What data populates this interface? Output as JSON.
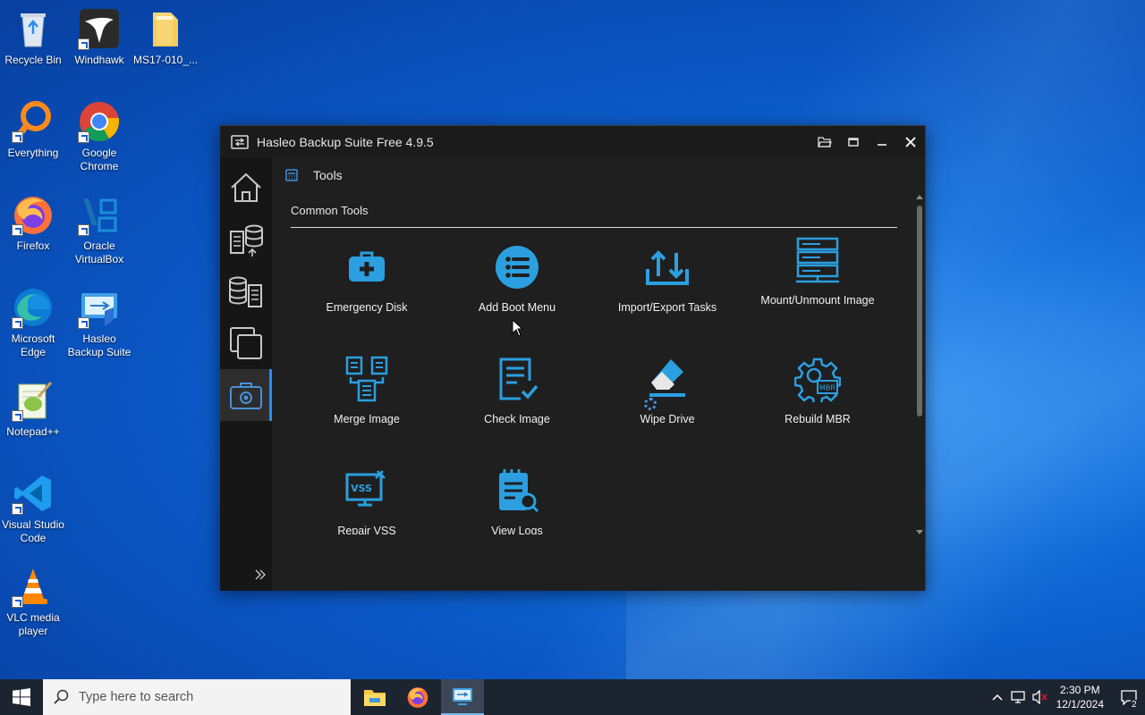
{
  "desktop": {
    "icons": [
      {
        "label": "Recycle Bin"
      },
      {
        "label": "Windhawk"
      },
      {
        "label": "MS17-010_..."
      },
      {
        "label": "Everything"
      },
      {
        "label": "Google Chrome"
      },
      {
        "label": "Firefox"
      },
      {
        "label": "Oracle VirtualBox"
      },
      {
        "label": "Microsoft Edge"
      },
      {
        "label": "Hasleo Backup Suite"
      },
      {
        "label": "Notepad++"
      },
      {
        "label": "Visual Studio Code"
      },
      {
        "label": "VLC media player"
      }
    ]
  },
  "window": {
    "title": "Hasleo Backup Suite Free 4.9.5",
    "breadcrumb": "Tools",
    "section_title": "Common Tools",
    "tools": [
      {
        "label": "Emergency Disk",
        "icon": "first-aid-kit-icon"
      },
      {
        "label": "Add Boot Menu",
        "icon": "list-circle-icon"
      },
      {
        "label": "Import/Export Tasks",
        "icon": "import-export-icon"
      },
      {
        "label": "Mount/Unmount Image",
        "icon": "server-icon"
      },
      {
        "label": "Merge Image",
        "icon": "merge-icon"
      },
      {
        "label": "Check Image",
        "icon": "check-document-icon"
      },
      {
        "label": "Wipe Drive",
        "icon": "eraser-icon"
      },
      {
        "label": "Rebuild MBR",
        "icon": "gear-mbr-icon"
      },
      {
        "label": "Repair VSS",
        "icon": "vss-icon"
      },
      {
        "label": "View Logs",
        "icon": "log-search-icon"
      }
    ],
    "accent_color": "#2b9fe0"
  },
  "taskbar": {
    "search_placeholder": "Type here to search",
    "time": "2:30 PM",
    "date": "12/1/2024",
    "notification_count": "2"
  }
}
